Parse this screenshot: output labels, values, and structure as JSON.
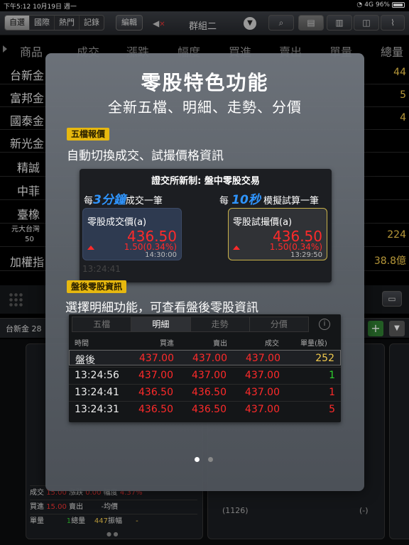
{
  "status": {
    "time": "下午5:12",
    "date": "10月19日 週一",
    "network": "4G",
    "battery": "96%"
  },
  "toolbar": {
    "segments": [
      "自選",
      "國際",
      "熱門",
      "記錄"
    ],
    "edit": "編輯",
    "mute_icon": "speaker-muted-icon",
    "group": "群組二"
  },
  "columns": [
    "商品",
    "成交",
    "漲跌",
    "幅度",
    "買進",
    "賣出",
    "單量",
    "總量"
  ],
  "stocks": [
    {
      "name": "台新金",
      "value": "44"
    },
    {
      "name": "富邦金",
      "value": "5"
    },
    {
      "name": "國泰金",
      "value": "4"
    },
    {
      "name": "新光金",
      "value": ""
    },
    {
      "name": "精誠",
      "value": ""
    },
    {
      "name": "中菲",
      "value": ""
    },
    {
      "name": "臺橡",
      "value": ""
    },
    {
      "name": "元大台灣",
      "name2": "50",
      "value": "224"
    },
    {
      "name": "加權指",
      "value": "38.8億"
    }
  ],
  "detail": {
    "stock": "台新金 28",
    "labels": [
      "成交",
      "漲跌",
      "幅度",
      "買進",
      "賣出",
      "均價",
      "單量",
      "總量",
      "振幅"
    ],
    "trade": "15.00",
    "change": "0.00",
    "pct": "4.37%",
    "bid": "15.00",
    "avg": "-",
    "unit_vol": "1",
    "total_vol": "447",
    "amplitude": "-",
    "code": "(1126)",
    "code_val": "(-)"
  },
  "modal": {
    "title": "零股特色功能",
    "subtitle": "全新五檔、明細、走勢、分價",
    "badge1": "五檔報價",
    "line1": "自動切換成交、試撮價格資訊",
    "fig1": {
      "header": "證交所新制: 盤中零股交易",
      "left_pre": "每",
      "left_num": "3分鐘",
      "left_post": "成交一筆",
      "right_pre": "每",
      "right_num": "10秒",
      "right_post": "模擬試算一筆",
      "card1": {
        "title": "零股成交價(a)",
        "price": "436.50",
        "change": "1.50(0.34%)",
        "time": "14:30:00"
      },
      "card2": {
        "title": "零股試撮價(a)",
        "price": "436.50",
        "change": "1.50(0.34%)",
        "time": "13:29:50"
      },
      "ghost": "13:24:41"
    },
    "badge2": "盤後零股資訊",
    "line2": "選擇明細功能，可查看盤後零股資訊",
    "fig2": {
      "tabs": [
        "五檔",
        "明細",
        "走勢",
        "分價"
      ],
      "active_tab": 1,
      "headers": [
        "時間",
        "買進",
        "賣出",
        "成交",
        "單量(股)"
      ],
      "rows": [
        [
          "盤後",
          "437.00",
          "437.00",
          "437.00",
          "252"
        ],
        [
          "13:24:56",
          "437.00",
          "437.00",
          "437.00",
          "1"
        ],
        [
          "13:24:41",
          "436.50",
          "436.50",
          "437.00",
          "1"
        ],
        [
          "13:24:31",
          "436.50",
          "436.50",
          "437.00",
          "5"
        ]
      ]
    },
    "page_count": 2,
    "current_page": 1
  },
  "colors": {
    "up": "#ff2a2a",
    "vol": "#2fd12f",
    "accent": "#e7b80f",
    "blue": "#2f95ff"
  }
}
